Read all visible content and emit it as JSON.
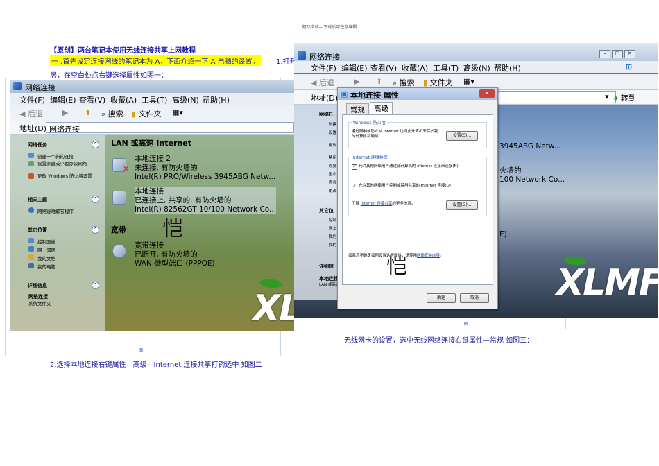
{
  "doc": {
    "header": "精品文档---下载后可任意编辑",
    "title": "【原创】两台笔记本使用无线连接共享上网教程",
    "step1": "一 .首先设定连接网线的笔记本为 A，下面介绍一下 A 电脑的设置。",
    "step1_tail": "1.打开",
    "step1_line2": "居，在空白处点右键选择属性如图一：",
    "step2": "2.选择本地连接右键属性—高级—Internet 连接共享打钩选中  如图二",
    "step3": "无线网卡的设置，选中无线网络连接右键属性—常规  如图三：",
    "fig1_caption": "图一",
    "fig2_caption": "图二"
  },
  "window": {
    "title": "网络连接",
    "menu": [
      "文件(F)",
      "编辑(E)",
      "查看(V)",
      "收藏(A)",
      "工具(T)",
      "高级(N)",
      "帮助(H)"
    ],
    "toolbar": {
      "back": "后退",
      "search": "搜索",
      "folders": "文件夹"
    },
    "address_label": "地址(D)",
    "address_value": "网络连接",
    "go": "转到"
  },
  "left_pane": {
    "network_tasks": "网络任务",
    "network_tasks_short": "网络任",
    "tasks": [
      "创建一个新的连接",
      "设置家庭或小型办公网络",
      "更改 Windows 防火墙设置"
    ],
    "related": "相关主题",
    "related_items": [
      "网络疑难解答程序"
    ],
    "other": "其它位置",
    "other_short": "其它位",
    "other_items": [
      "控制面板",
      "网上邻居",
      "我的文档",
      "我的电脑"
    ],
    "details": "详细信息",
    "details_short": "详细信",
    "details_title": "网络连接",
    "details_sub": "系统文件夹",
    "w2_details_title": "本地连接",
    "w2_details_sub": "LAN 或高速 Internet",
    "w2_task_short": [
      "创建",
      "设置",
      "更改",
      "禁用",
      "修复",
      "重命",
      "查看",
      "更改"
    ],
    "w2_other_short": [
      "控制",
      "网上",
      "我的",
      "我的"
    ]
  },
  "right_pane": {
    "lan_header": "LAN 或高速 Internet",
    "conn1": {
      "name": "本地连接 2",
      "status": "未连接, 有防火墙的",
      "device": "Intel(R) PRO/Wireless 3945ABG Netw..."
    },
    "conn2": {
      "name": "本地连接",
      "status": "已连接上, 共享的, 有防火墙的",
      "device": "Intel(R) 82562GT 10/100 Network Co..."
    },
    "broadband_header": "宽带",
    "conn3": {
      "name": "宽带连接",
      "status": "已断开, 有防火墙的",
      "device": "WAN 微型端口 (PPPOE)"
    },
    "w2_device1": "3945ABG Netw...",
    "w2_status2": "火墙的",
    "w2_device2": "100 Network Co...",
    "w2_frag": "E)"
  },
  "dialog": {
    "title": "本地连接 属性",
    "tabs": [
      "常规",
      "高级"
    ],
    "firewall_group": "Windows 防火墙",
    "firewall_text": "通过限制或防止从 Internet 访问此计算机来保护我的计算机和网络",
    "settings_btn": "设置(S)...",
    "ics_group": "Internet 连接共享",
    "ics_check1": "允许其他网络用户通过此计算机的 Internet 连接来连接(N)",
    "ics_check2": "允许其他网络用户控制或禁用共享的 Internet 连接(O)",
    "learn_prefix": "了解",
    "learn_link": "Internet 连接共享",
    "learn_suffix": "的更多信息。",
    "settings_btn2": "设置(G)...",
    "help_text": "如果您不确定如何设置这些属性，请使用",
    "help_link": "网络安装向导",
    "help_end": "。",
    "ok": "确定",
    "cancel": "取消"
  },
  "watermark": {
    "logo": "XLMF",
    "sign": "恺"
  }
}
